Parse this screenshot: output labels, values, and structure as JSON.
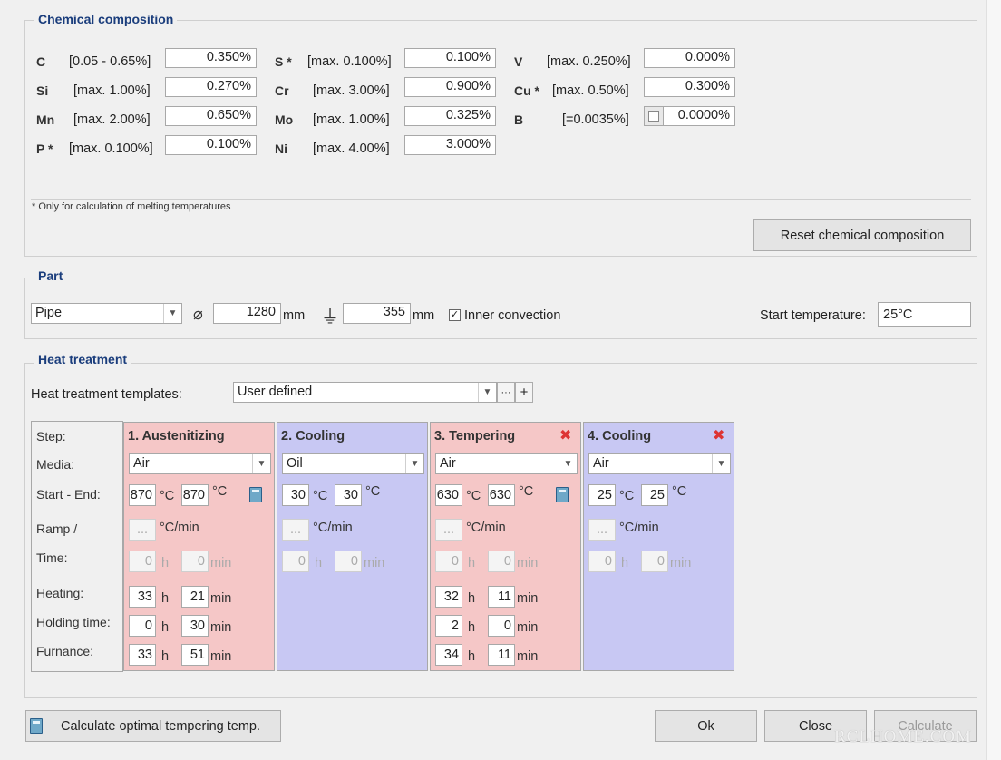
{
  "chem": {
    "title": "Chemical composition",
    "elements": [
      {
        "sym": "C",
        "range": "[0.05 - 0.65%]",
        "value": "0.350%"
      },
      {
        "sym": "Si",
        "range": "[max. 1.00%]",
        "value": "0.270%"
      },
      {
        "sym": "Mn",
        "range": "[max. 2.00%]",
        "value": "0.650%"
      },
      {
        "sym": "P *",
        "range": "[max. 0.100%]",
        "value": "0.100%"
      },
      {
        "sym": "S *",
        "range": "[max. 0.100%]",
        "value": "0.100%"
      },
      {
        "sym": "Cr",
        "range": "[max. 3.00%]",
        "value": "0.900%"
      },
      {
        "sym": "Mo",
        "range": "[max. 1.00%]",
        "value": "0.325%"
      },
      {
        "sym": "Ni",
        "range": "[max. 4.00%]",
        "value": "3.000%"
      },
      {
        "sym": "V",
        "range": "[max. 0.250%]",
        "value": "0.000%"
      },
      {
        "sym": "Cu *",
        "range": "[max. 0.50%]",
        "value": "0.300%"
      },
      {
        "sym": "B",
        "range": "[=0.0035%]",
        "value": "0.0000%"
      }
    ],
    "footnote": "* Only for calculation of melting temperatures",
    "reset_label": "Reset chemical composition"
  },
  "part": {
    "title": "Part",
    "shape": "Pipe",
    "diameter": "1280",
    "diameter_unit": "mm",
    "wall": "355",
    "wall_unit": "mm",
    "inner_convection_label": "Inner convection",
    "inner_convection_checked": true,
    "start_temp_label": "Start temperature:",
    "start_temp": "25°C"
  },
  "heat": {
    "title": "Heat treatment",
    "templates_label": "Heat treatment templates:",
    "template": "User defined",
    "more_label": "···",
    "add_label": "+",
    "row_labels": {
      "step": "Step:",
      "media": "Media:",
      "start_end": "Start - End:",
      "ramp": "Ramp /",
      "time": "Time:",
      "heating": "Heating:",
      "holding": "Holding time:",
      "furnance": "Furnance:"
    },
    "units": {
      "c": "°C",
      "cmin": "°C/min",
      "h": "h",
      "min": "min",
      "dots": "..."
    },
    "steps": [
      {
        "title": "1. Austenitizing",
        "media": "Air",
        "start": "870",
        "end": "870",
        "time_h": "0",
        "time_min": "0",
        "heat_h": "33",
        "heat_min": "21",
        "hold_h": "0",
        "hold_min": "30",
        "furn_h": "33",
        "furn_min": "51",
        "color": "#f5c7c7"
      },
      {
        "title": "2. Cooling",
        "media": "Oil",
        "start": "30",
        "end": "30",
        "time_h": "0",
        "time_min": "0",
        "color": "#c8c8f3"
      },
      {
        "title": "3. Tempering",
        "media": "Air",
        "start": "630",
        "end": "630",
        "time_h": "0",
        "time_min": "0",
        "heat_h": "32",
        "heat_min": "11",
        "hold_h": "2",
        "hold_min": "0",
        "furn_h": "34",
        "furn_min": "11",
        "color": "#f5c7c7"
      },
      {
        "title": "4. Cooling",
        "media": "Air",
        "start": "25",
        "end": "25",
        "time_h": "0",
        "time_min": "0",
        "color": "#c8c8f3"
      }
    ]
  },
  "buttons": {
    "calc_optimal": "Calculate optimal tempering temp.",
    "ok": "Ok",
    "close": "Close",
    "calculate": "Calculate"
  },
  "watermark": "RCLHOME.COM"
}
